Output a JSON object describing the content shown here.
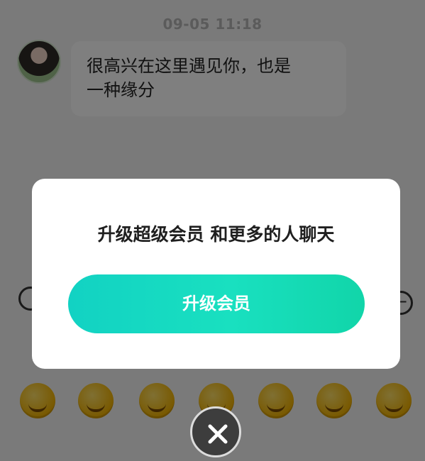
{
  "chat": {
    "timestamp": "09-05 11:18",
    "message": "很高兴在这里遇见你，也是\n一种缘分"
  },
  "dialog": {
    "message": "升级超级会员 和更多的人聊天",
    "button_label": "升级会员"
  },
  "icons": {
    "close": "close-icon",
    "emoji": [
      "grin-emoji-icon",
      "wink-emoji-icon",
      "sweat-emoji-icon",
      "smile-emoji-icon",
      "thinking-emoji-icon",
      "hammer-emoji-icon",
      "sly-emoji-icon"
    ]
  },
  "colors": {
    "button_start": "#12d2c3",
    "button_end": "#11d5a9",
    "overlay": "#7a7a7a"
  }
}
